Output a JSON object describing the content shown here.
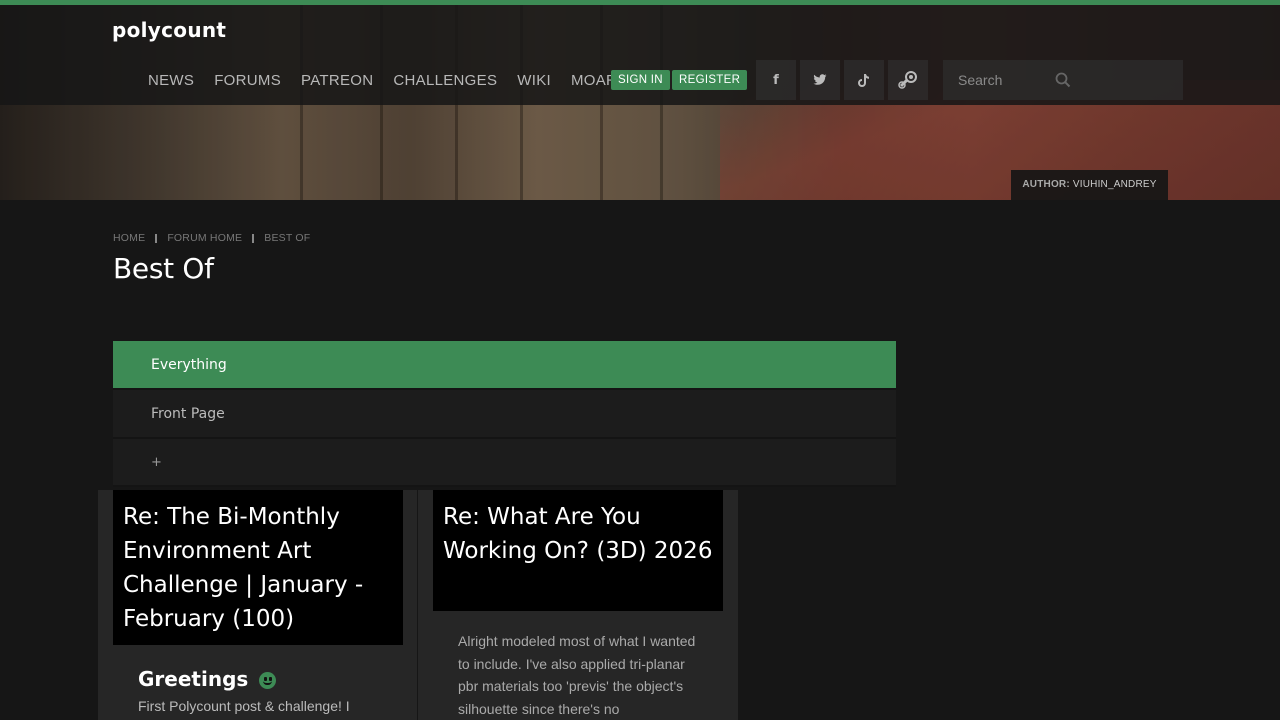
{
  "header": {
    "logo": "polycount",
    "nav": [
      "NEWS",
      "FORUMS",
      "PATREON",
      "CHALLENGES",
      "WIKI",
      "MOAR"
    ],
    "sign_in": "SIGN IN",
    "register": "REGISTER",
    "social": [
      {
        "name": "facebook-icon",
        "glyph": "f"
      },
      {
        "name": "twitter-icon",
        "glyph": "🐦"
      },
      {
        "name": "tiktok-icon",
        "glyph": "♪"
      },
      {
        "name": "steam-icon",
        "glyph": "⚙"
      }
    ],
    "search_placeholder": "Search",
    "author_label": "AUTHOR:",
    "author_name": "VIUHIN_ANDREY"
  },
  "breadcrumb": [
    "HOME",
    "FORUM HOME",
    "BEST OF"
  ],
  "page_title": "Best Of",
  "categories": [
    {
      "label": "Everything",
      "active": true
    },
    {
      "label": "Front Page",
      "active": false
    },
    {
      "label": "+",
      "active": false
    }
  ],
  "cards": [
    {
      "title": "Re: The Bi-Monthly Environment Art Challenge | January - February (100)",
      "heading": "Greetings",
      "excerpt": "First Polycount post & challenge! I"
    },
    {
      "title": "Re: What Are You Working On? (3D) 2026",
      "excerpt": "Alright modeled most of what I wanted to include. I've also applied tri-planar pbr materials too 'previs' the object's silhouette since there's no"
    }
  ],
  "colors": {
    "accent": "#3d8b55",
    "background": "#161616"
  }
}
